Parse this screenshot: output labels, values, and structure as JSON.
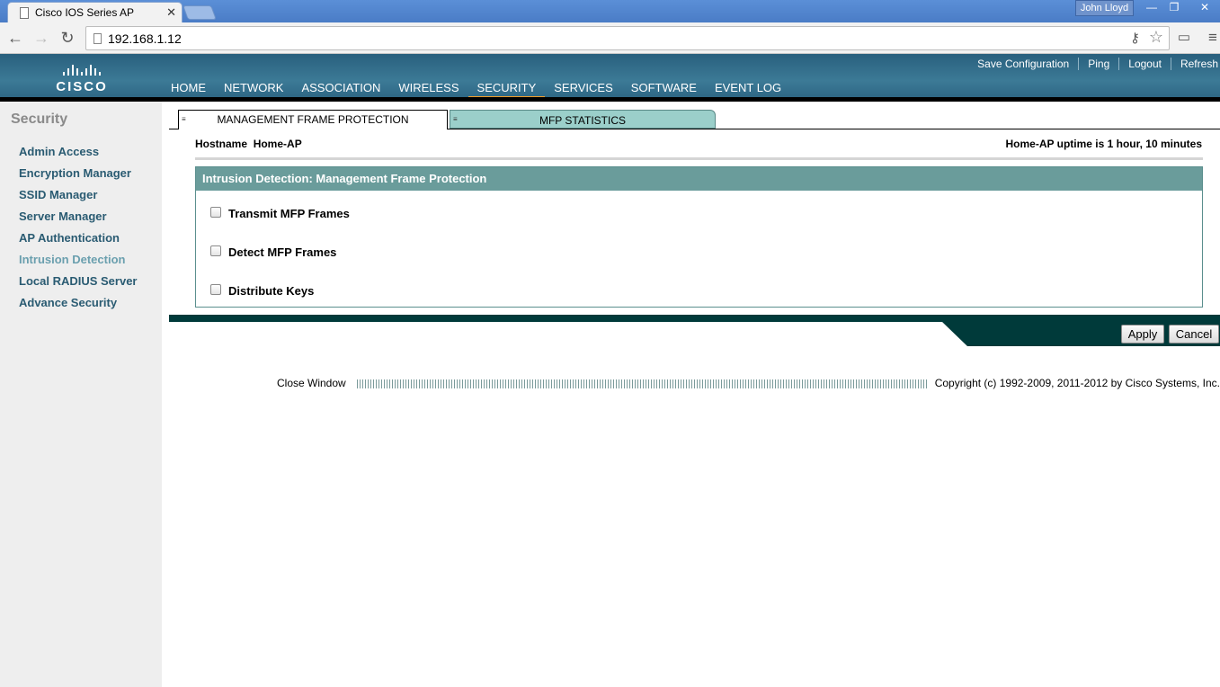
{
  "browser": {
    "tab_title": "Cisco IOS Series AP",
    "tab_close": "✕",
    "user": "John Lloyd",
    "url": "192.168.1.12",
    "win_minimize": "—",
    "win_restore": "❐",
    "win_close": "✕"
  },
  "brand": {
    "logo_text": "CISCO"
  },
  "top_links": [
    "Save Configuration",
    "Ping",
    "Logout",
    "Refresh"
  ],
  "menu": [
    {
      "label": "HOME"
    },
    {
      "label": "NETWORK"
    },
    {
      "label": "ASSOCIATION"
    },
    {
      "label": "WIRELESS"
    },
    {
      "label": "SECURITY",
      "active": true
    },
    {
      "label": "SERVICES"
    },
    {
      "label": "SOFTWARE"
    },
    {
      "label": "EVENT LOG"
    }
  ],
  "sidebar": {
    "title": "Security",
    "items": [
      {
        "label": "Admin Access"
      },
      {
        "label": "Encryption Manager"
      },
      {
        "label": "SSID Manager"
      },
      {
        "label": "Server Manager"
      },
      {
        "label": "AP Authentication"
      },
      {
        "label": "Intrusion Detection",
        "active": true
      },
      {
        "label": "Local RADIUS Server"
      },
      {
        "label": "Advance Security"
      }
    ]
  },
  "tabs": [
    {
      "label": "MANAGEMENT FRAME PROTECTION",
      "active": true
    },
    {
      "label": "MFP STATISTICS"
    }
  ],
  "hostname_label": "Hostname",
  "hostname_value": "Home-AP",
  "uptime": "Home-AP uptime is 1 hour, 10 minutes",
  "panel": {
    "title": "Intrusion Detection: Management Frame Protection",
    "options": [
      {
        "label": "Transmit MFP Frames",
        "checked": false
      },
      {
        "label": "Detect MFP Frames",
        "checked": false
      },
      {
        "label": "Distribute Keys",
        "checked": false
      }
    ]
  },
  "buttons": {
    "apply": "Apply",
    "cancel": "Cancel"
  },
  "footer": {
    "close_window": "Close Window",
    "copyright": "Copyright (c) 1992-2009, 2011-2012 by Cisco Systems, Inc."
  }
}
